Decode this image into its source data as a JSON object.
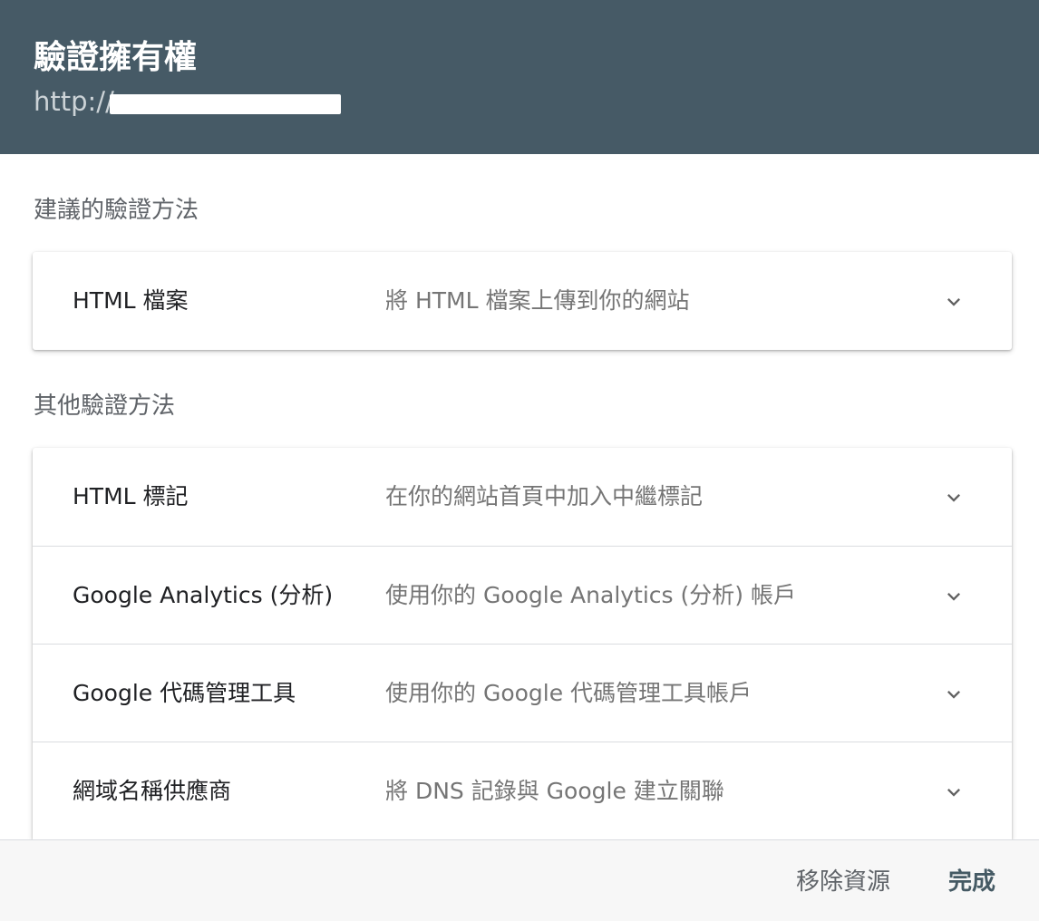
{
  "dialog": {
    "title": "驗證擁有權",
    "url_prefix": "http://"
  },
  "recommended": {
    "label": "建議的驗證方法",
    "items": [
      {
        "name": "HTML 檔案",
        "description": "將 HTML 檔案上傳到你的網站"
      }
    ]
  },
  "other": {
    "label": "其他驗證方法",
    "items": [
      {
        "name": "HTML 標記",
        "description": "在你的網站首頁中加入中繼標記"
      },
      {
        "name": "Google Analytics (分析)",
        "description": "使用你的 Google Analytics (分析) 帳戶"
      },
      {
        "name": "Google 代碼管理工具",
        "description": "使用你的 Google 代碼管理工具帳戶"
      },
      {
        "name": "網域名稱供應商",
        "description": "將 DNS 記錄與 Google 建立關聯"
      }
    ]
  },
  "footer": {
    "remove_label": "移除資源",
    "done_label": "完成"
  },
  "icons": {
    "row_expand": "chevron-down-icon"
  },
  "colors": {
    "header_bg": "#465a66",
    "primary_text": "#202124",
    "secondary_text": "#757575",
    "done_button": "#455a64"
  }
}
